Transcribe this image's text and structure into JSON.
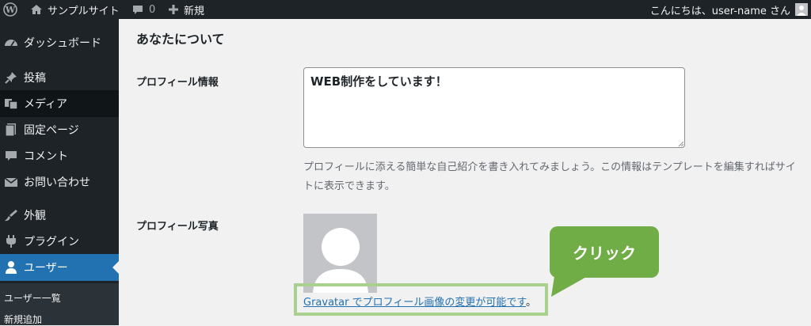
{
  "admin_bar": {
    "site_name": "サンプルサイト",
    "comments_count": "0",
    "new_label": "新規",
    "greeting": "こんにちは、user-name さん"
  },
  "sidebar": {
    "items": [
      {
        "label": "ダッシュボード",
        "icon": "dashboard-icon"
      },
      {
        "label": "投稿",
        "icon": "pushpin-icon"
      },
      {
        "label": "メディア",
        "icon": "media-icon"
      },
      {
        "label": "固定ページ",
        "icon": "pages-icon"
      },
      {
        "label": "コメント",
        "icon": "comment-icon"
      },
      {
        "label": "お問い合わせ",
        "icon": "mail-icon"
      },
      {
        "label": "外観",
        "icon": "brush-icon"
      },
      {
        "label": "プラグイン",
        "icon": "plugin-icon"
      },
      {
        "label": "ユーザー",
        "icon": "user-icon"
      }
    ],
    "submenu": [
      "ユーザー一覧",
      "新規追加"
    ]
  },
  "main": {
    "section_title": "あなたについて",
    "bio_label": "プロフィール情報",
    "bio_value": "WEB制作をしています！",
    "bio_description": "プロフィールに添える簡単な自己紹介を書き入れてみましょう。この情報はテンプレートを編集すればサイトに表示できます。",
    "photo_label": "プロフィール写真",
    "gravatar_link": "Gravatar でプロフィール画像の変更が可能です",
    "gravatar_suffix": "。"
  },
  "annotation": {
    "callout_text": "クリック",
    "callout_color": "#70ad47",
    "frame_color": "#a9d18e"
  },
  "colors": {
    "admin_dark": "#1d2327",
    "active_blue": "#2271b1",
    "link_blue": "#2271b1"
  }
}
